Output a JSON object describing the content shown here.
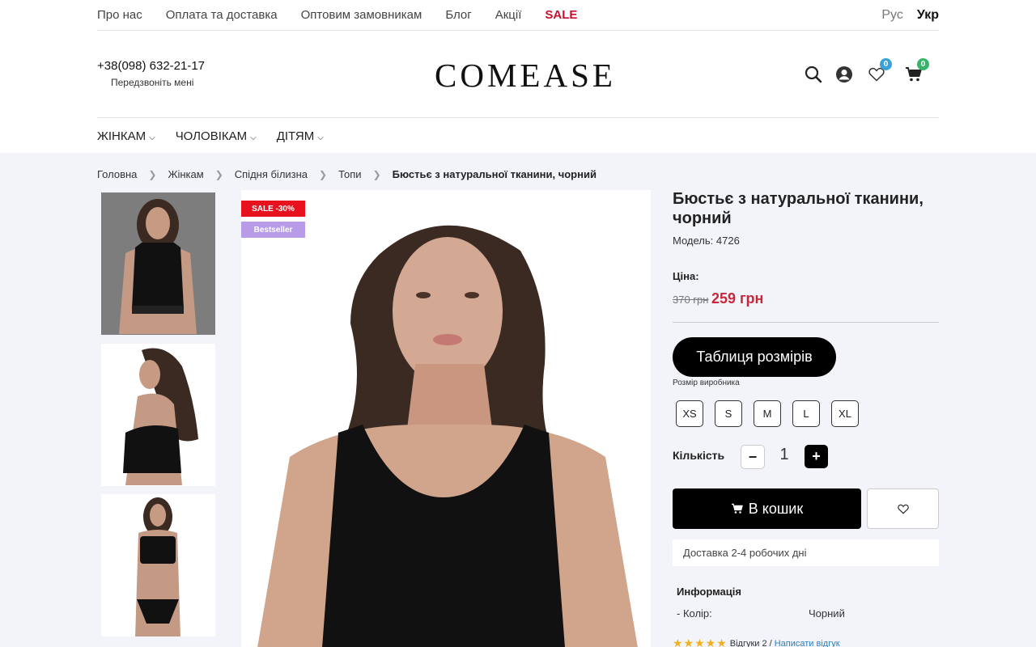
{
  "topnav": {
    "items": [
      "Про нас",
      "Оплата та доставка",
      "Оптовим замовникам",
      "Блог",
      "Акції"
    ],
    "sale": "SALE"
  },
  "lang": {
    "ru": "Рус",
    "ua": "Укр"
  },
  "header": {
    "phone": "+38(098) 632-21-17",
    "callback": "Передзвоніть мені",
    "logo": "COMEASE",
    "wishlist_count": "0",
    "cart_count": "0"
  },
  "catnav": [
    "ЖІНКАМ",
    "ЧОЛОВІКАМ",
    "ДІТЯМ"
  ],
  "breadcrumbs": [
    "Головна",
    "Жінкам",
    "Спідня білизна",
    "Топи",
    "Бюстьє з натуральної тканини, чорний"
  ],
  "tags": {
    "sale": "SALE -30%",
    "bestseller": "Bestseller"
  },
  "product": {
    "title": "Бюстьє з натуральної тканини, чорний",
    "model": "Модель: 4726",
    "price_label": "Ціна:",
    "old_price": "370 грн",
    "new_price": "259 грн",
    "size_table": "Таблиця розмірів",
    "size_maker": "Розмір виробника",
    "sizes": [
      "XS",
      "S",
      "M",
      "L",
      "XL"
    ],
    "qty_label": "Кількість",
    "qty": "1",
    "cart_button": "В кошик",
    "delivery": "Доставка 2-4 робочих дні",
    "info_title": "Информація",
    "color_label": "- Колір:",
    "color_value": "Чорний",
    "reviews_text": "Відгуки 2 /",
    "write_review": "Написати відгук"
  },
  "colors": {
    "accent_red": "#c8283a",
    "sale_red": "#e8121e",
    "bestseller": "#b79be8",
    "bg_content": "#f2f4fa"
  }
}
